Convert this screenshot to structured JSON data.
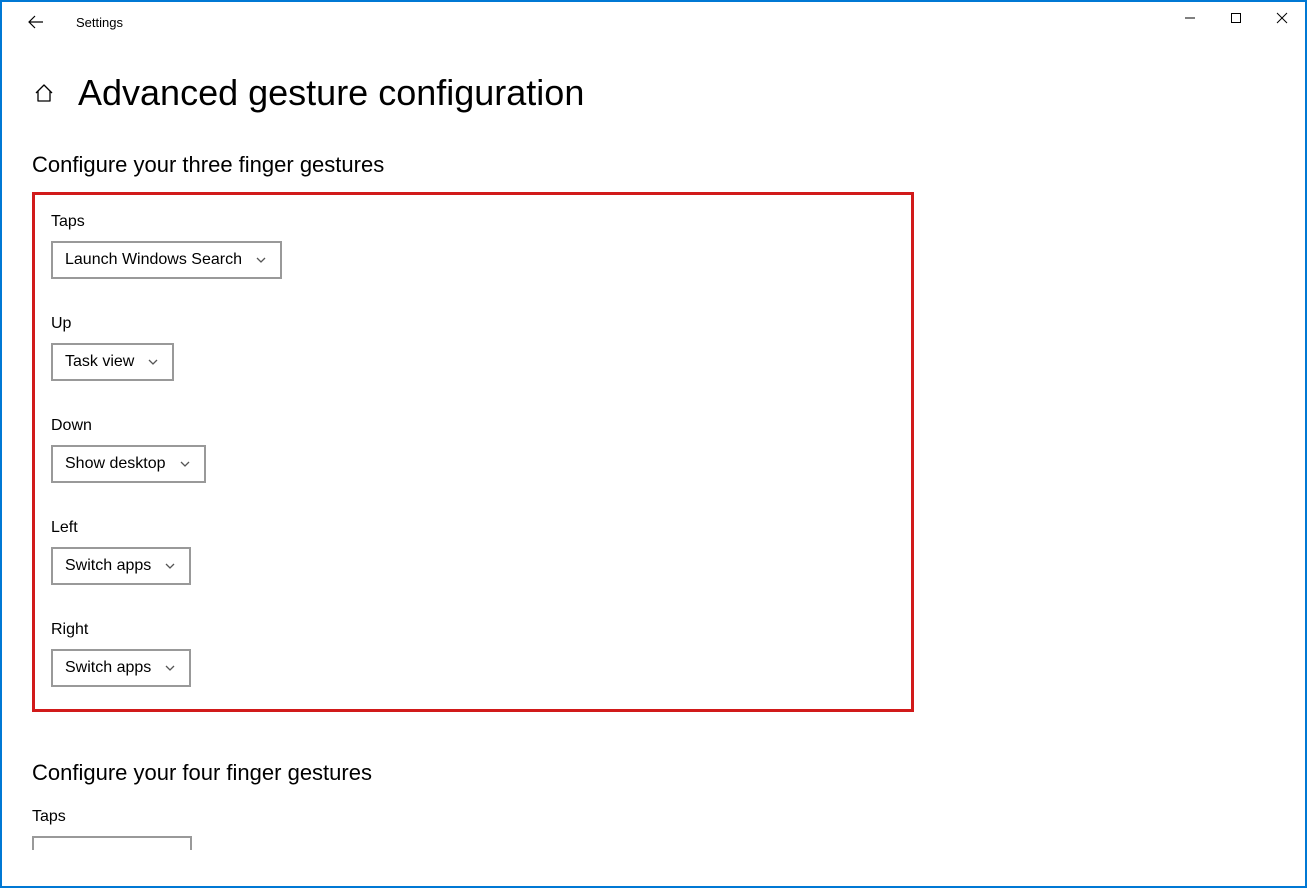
{
  "window": {
    "title": "Settings"
  },
  "page": {
    "heading": "Advanced gesture configuration"
  },
  "sections": {
    "three_finger": {
      "heading": "Configure your three finger gestures",
      "taps_label": "Taps",
      "taps_value": "Launch Windows Search",
      "up_label": "Up",
      "up_value": "Task view",
      "down_label": "Down",
      "down_value": "Show desktop",
      "left_label": "Left",
      "left_value": "Switch apps",
      "right_label": "Right",
      "right_value": "Switch apps"
    },
    "four_finger": {
      "heading": "Configure your four finger gestures",
      "taps_label": "Taps"
    }
  }
}
